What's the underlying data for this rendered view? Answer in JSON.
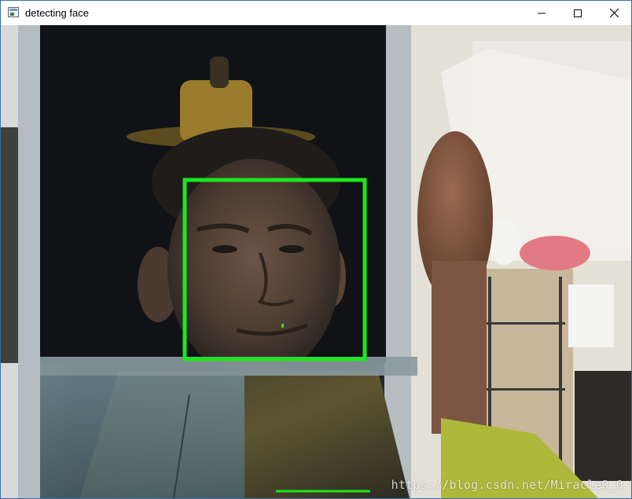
{
  "window": {
    "title": "detecting face",
    "controls": {
      "minimize": "minimize",
      "maximize": "maximize",
      "close": "close"
    }
  },
  "camera_view": {
    "detection_box_color": "#1ee61e",
    "detections": 1,
    "watermark": "https://blog.csdn.net/Miracle0_0"
  },
  "icons": {
    "app": "window-app-icon",
    "minimize": "minimize-icon",
    "maximize": "maximize-icon",
    "close": "close-icon"
  }
}
